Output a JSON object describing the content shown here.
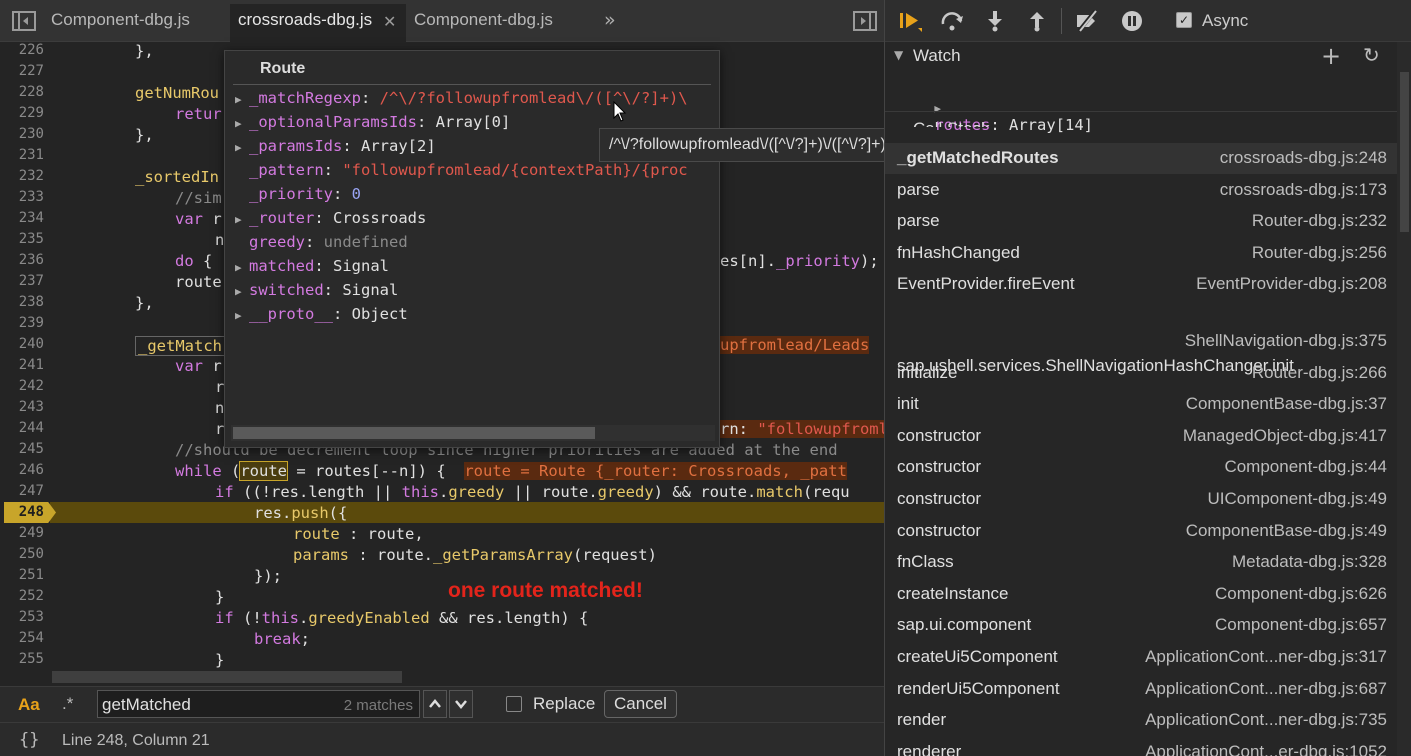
{
  "tabs": [
    {
      "label": "Component-dbg.js"
    },
    {
      "label": "crossroads-dbg.js"
    },
    {
      "label": "Component-dbg.js"
    }
  ],
  "editor": {
    "line_numbers": [
      "226",
      "227",
      "228",
      "229",
      "230",
      "231",
      "232",
      "233",
      "234",
      "235",
      "236",
      "237",
      "238",
      "239",
      "240",
      "241",
      "242",
      "243",
      "244",
      "245",
      "246",
      "247",
      "248",
      "249",
      "250",
      "251",
      "252",
      "253",
      "254",
      "255"
    ],
    "breakpoint_line": "248",
    "annotation": "one route matched!"
  },
  "popover": {
    "title": "Route",
    "rows": [
      {
        "name": "_matchRegexp",
        "value": "/^\\/?followupfromlead\\/([^\\/?]+)\\",
        "kind": "str",
        "expandable": true
      },
      {
        "name": "_optionalParamsIds",
        "value": "Array[0]",
        "kind": "val",
        "expandable": true
      },
      {
        "name": "_paramsIds",
        "value": "Array[2]",
        "kind": "val",
        "expandable": true
      },
      {
        "name": "_pattern",
        "value": "\"followupfromlead/{contextPath}/{proc",
        "kind": "str",
        "expandable": false
      },
      {
        "name": "_priority",
        "value": "0",
        "kind": "num",
        "expandable": false
      },
      {
        "name": "_router",
        "value": "Crossroads",
        "kind": "val",
        "expandable": true
      },
      {
        "name": "greedy",
        "value": "undefined",
        "kind": "undef",
        "expandable": false
      },
      {
        "name": "matched",
        "value": "Signal",
        "kind": "val",
        "expandable": true
      },
      {
        "name": "switched",
        "value": "Signal",
        "kind": "val",
        "expandable": true
      },
      {
        "name": "__proto__",
        "value": "Object",
        "kind": "val",
        "expandable": true
      }
    ],
    "tooltip": "/^\\/?followupfromlead\\/([^\\/?]+)\\/([^\\/?]+)\\/?$/i"
  },
  "search": {
    "case_label": "Aa",
    "regex_label": ".*",
    "query": "getMatched",
    "matches": "2 matches",
    "replace_label": "Replace",
    "cancel_label": "Cancel"
  },
  "status": {
    "position": "Line 248, Column 21",
    "braces": "{}"
  },
  "debugger": {
    "async_label": "Async",
    "watch_title": "Watch",
    "watch_expr": {
      "name": "routes",
      "value": "Array[14]"
    },
    "callstack_title": "Call Stack",
    "frames": [
      {
        "fn": "_getMatchedRoutes",
        "loc": "crossroads-dbg.js:248"
      },
      {
        "fn": "parse",
        "loc": "crossroads-dbg.js:173"
      },
      {
        "fn": "parse",
        "loc": "Router-dbg.js:232"
      },
      {
        "fn": "fnHashChanged",
        "loc": "Router-dbg.js:256"
      },
      {
        "fn": "EventProvider.fireEvent",
        "loc": "EventProvider-dbg.js:208"
      },
      {
        "fn": "sap.ushell.services.ShellNavigationHashChanger.init",
        "loc": "ShellNavigation-dbg.js:375"
      },
      {
        "fn": "initialize",
        "loc": "Router-dbg.js:266"
      },
      {
        "fn": "init",
        "loc": "ComponentBase-dbg.js:37"
      },
      {
        "fn": "constructor",
        "loc": "ManagedObject-dbg.js:417"
      },
      {
        "fn": "constructor",
        "loc": "Component-dbg.js:44"
      },
      {
        "fn": "constructor",
        "loc": "UIComponent-dbg.js:49"
      },
      {
        "fn": "constructor",
        "loc": "ComponentBase-dbg.js:49"
      },
      {
        "fn": "fnClass",
        "loc": "Metadata-dbg.js:328"
      },
      {
        "fn": "createInstance",
        "loc": "Component-dbg.js:626"
      },
      {
        "fn": "sap.ui.component",
        "loc": "Component-dbg.js:657"
      },
      {
        "fn": "createUi5Component",
        "loc": "ApplicationCont...ner-dbg.js:317"
      },
      {
        "fn": "renderUi5Component",
        "loc": "ApplicationCont...ner-dbg.js:687"
      },
      {
        "fn": "render",
        "loc": "ApplicationCont...ner-dbg.js:735"
      },
      {
        "fn": "renderer",
        "loc": "ApplicationCont...er-dbg.js:1052"
      }
    ]
  },
  "colors": {
    "accent": "#e8a21a",
    "breakpoint": "#c8a52a",
    "annotation": "#e3241b"
  }
}
